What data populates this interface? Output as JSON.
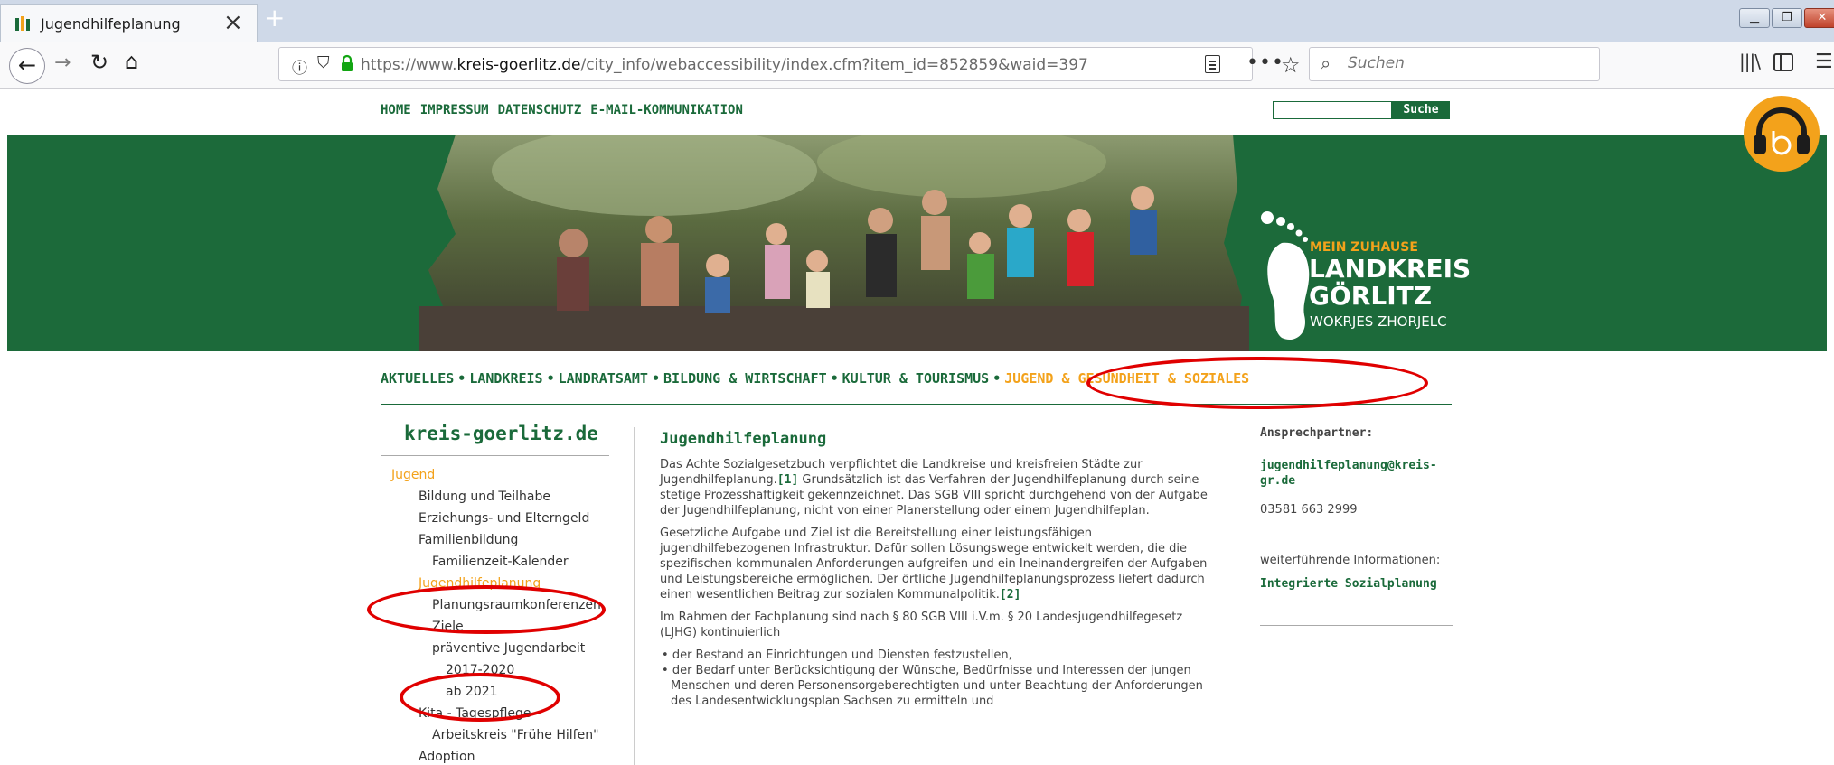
{
  "browser": {
    "tab_title": "Jugendhilfeplanung",
    "tab_close": "×",
    "new_tab": "+",
    "url_prefix": "https://www.",
    "url_domain": "kreis-goerlitz.de",
    "url_path": "/city_info/webaccessibility/index.cfm?item_id=852859&waid=397",
    "search_placeholder": "Suchen",
    "icons": [
      "back-icon",
      "forward-icon",
      "reload-icon",
      "home-icon",
      "info-icon",
      "shield-icon",
      "lock-icon",
      "reader-icon",
      "more-icon",
      "star-icon",
      "search-icon",
      "library-icon",
      "sidebar-icon",
      "menu-icon"
    ]
  },
  "topnav": {
    "items": [
      "HOME",
      "IMPRESSUM",
      "DATENSCHUTZ",
      "E-MAIL-KOMMUNIKATION"
    ],
    "search_button": "Suche"
  },
  "brand": {
    "tagline": "MEIN ZUHAUSE",
    "line1": "LANDKREIS",
    "line2": "GÖRLITZ",
    "subtitle": "WOKRJES ZHORJELC"
  },
  "mainnav": {
    "items": [
      "AKTUELLES",
      "LANDKREIS",
      "LANDRATSAMT",
      "BILDUNG & WIRTSCHAFT",
      "KULTUR & TOURISMUS",
      "JUGEND & GESUNDHEIT & SOZIALES"
    ],
    "separator": "•"
  },
  "left": {
    "title": "kreis-goerlitz.de",
    "items": [
      {
        "label": "Jugend",
        "level": 0,
        "active": true
      },
      {
        "label": "Bildung und Teilhabe",
        "level": 1
      },
      {
        "label": "Erziehungs- und Elterngeld",
        "level": 1
      },
      {
        "label": "Familienbildung",
        "level": 1
      },
      {
        "label": "Familienzeit-Kalender",
        "level": 2
      },
      {
        "label": "Jugendhilfeplanung",
        "level": 1,
        "active": true
      },
      {
        "label": "Planungsraumkonferenzen",
        "level": 2
      },
      {
        "label": "Ziele",
        "level": 2
      },
      {
        "label": "präventive Jugendarbeit",
        "level": 2
      },
      {
        "label": "2017-2020",
        "level": 3
      },
      {
        "label": "ab 2021",
        "level": 3
      },
      {
        "label": "Kita - Tagespflege",
        "level": 1
      },
      {
        "label": "Arbeitskreis \"Frühe Hilfen\"",
        "level": 2
      },
      {
        "label": "Adoption",
        "level": 1
      }
    ]
  },
  "content": {
    "title": "Jugendhilfeplanung",
    "p1_a": "Das Achte Sozialgesetzbuch verpflichtet die Landkreise und kreisfreien Städte zur Jugendhilfeplanung.",
    "fn1": "[1]",
    "p1_b": " Grundsätzlich ist das Verfahren der Jugendhilfeplanung durch seine stetige Prozesshaftigkeit gekennzeichnet. Das SGB VIII spricht durchgehend von der Aufgabe der Jugendhilfeplanung, nicht von einer Planerstellung oder einem Jugendhilfeplan.",
    "p2_a": "Gesetzliche Aufgabe und Ziel ist die Bereitstellung einer leistungsfähigen jugendhilfebezogenen Infrastruktur. Dafür sollen Lösungswege entwickelt werden, die die spezifischen kommunalen Anforderungen aufgreifen und ein Ineinandergreifen der Aufgaben und Leistungsbereiche ermöglichen. Der örtliche Jugendhilfeplanungsprozess liefert dadurch einen wesentlichen Beitrag zur sozialen Kommunalpolitik.",
    "fn2": "[2]",
    "p3": "Im Rahmen der Fachplanung sind nach § 80 SGB VIII i.V.m. § 20 Landesjugendhilfegesetz (LJHG) kontinuierlich",
    "bullets": [
      "der Bestand an Einrichtungen und Diensten festzustellen,",
      "der Bedarf unter Berücksichtigung der Wünsche, Bedürfnisse und Interessen der jungen Menschen und deren Personensorgeberechtigten und unter Beachtung der Anforderungen des Landesentwicklungsplan Sachsen zu ermitteln und"
    ],
    "bullet_char": "•"
  },
  "right": {
    "title": "Ansprechpartner:",
    "email": "jugendhilfeplanung@kreis-gr.de",
    "phone": "03581 663 2999",
    "weiter": "weiterführende Informationen:",
    "link": "Integrierte Sozialplanung"
  },
  "colors": {
    "brand_green": "#1a6a3a",
    "accent_orange": "#f3a21b",
    "annotation_red": "#e00000"
  }
}
